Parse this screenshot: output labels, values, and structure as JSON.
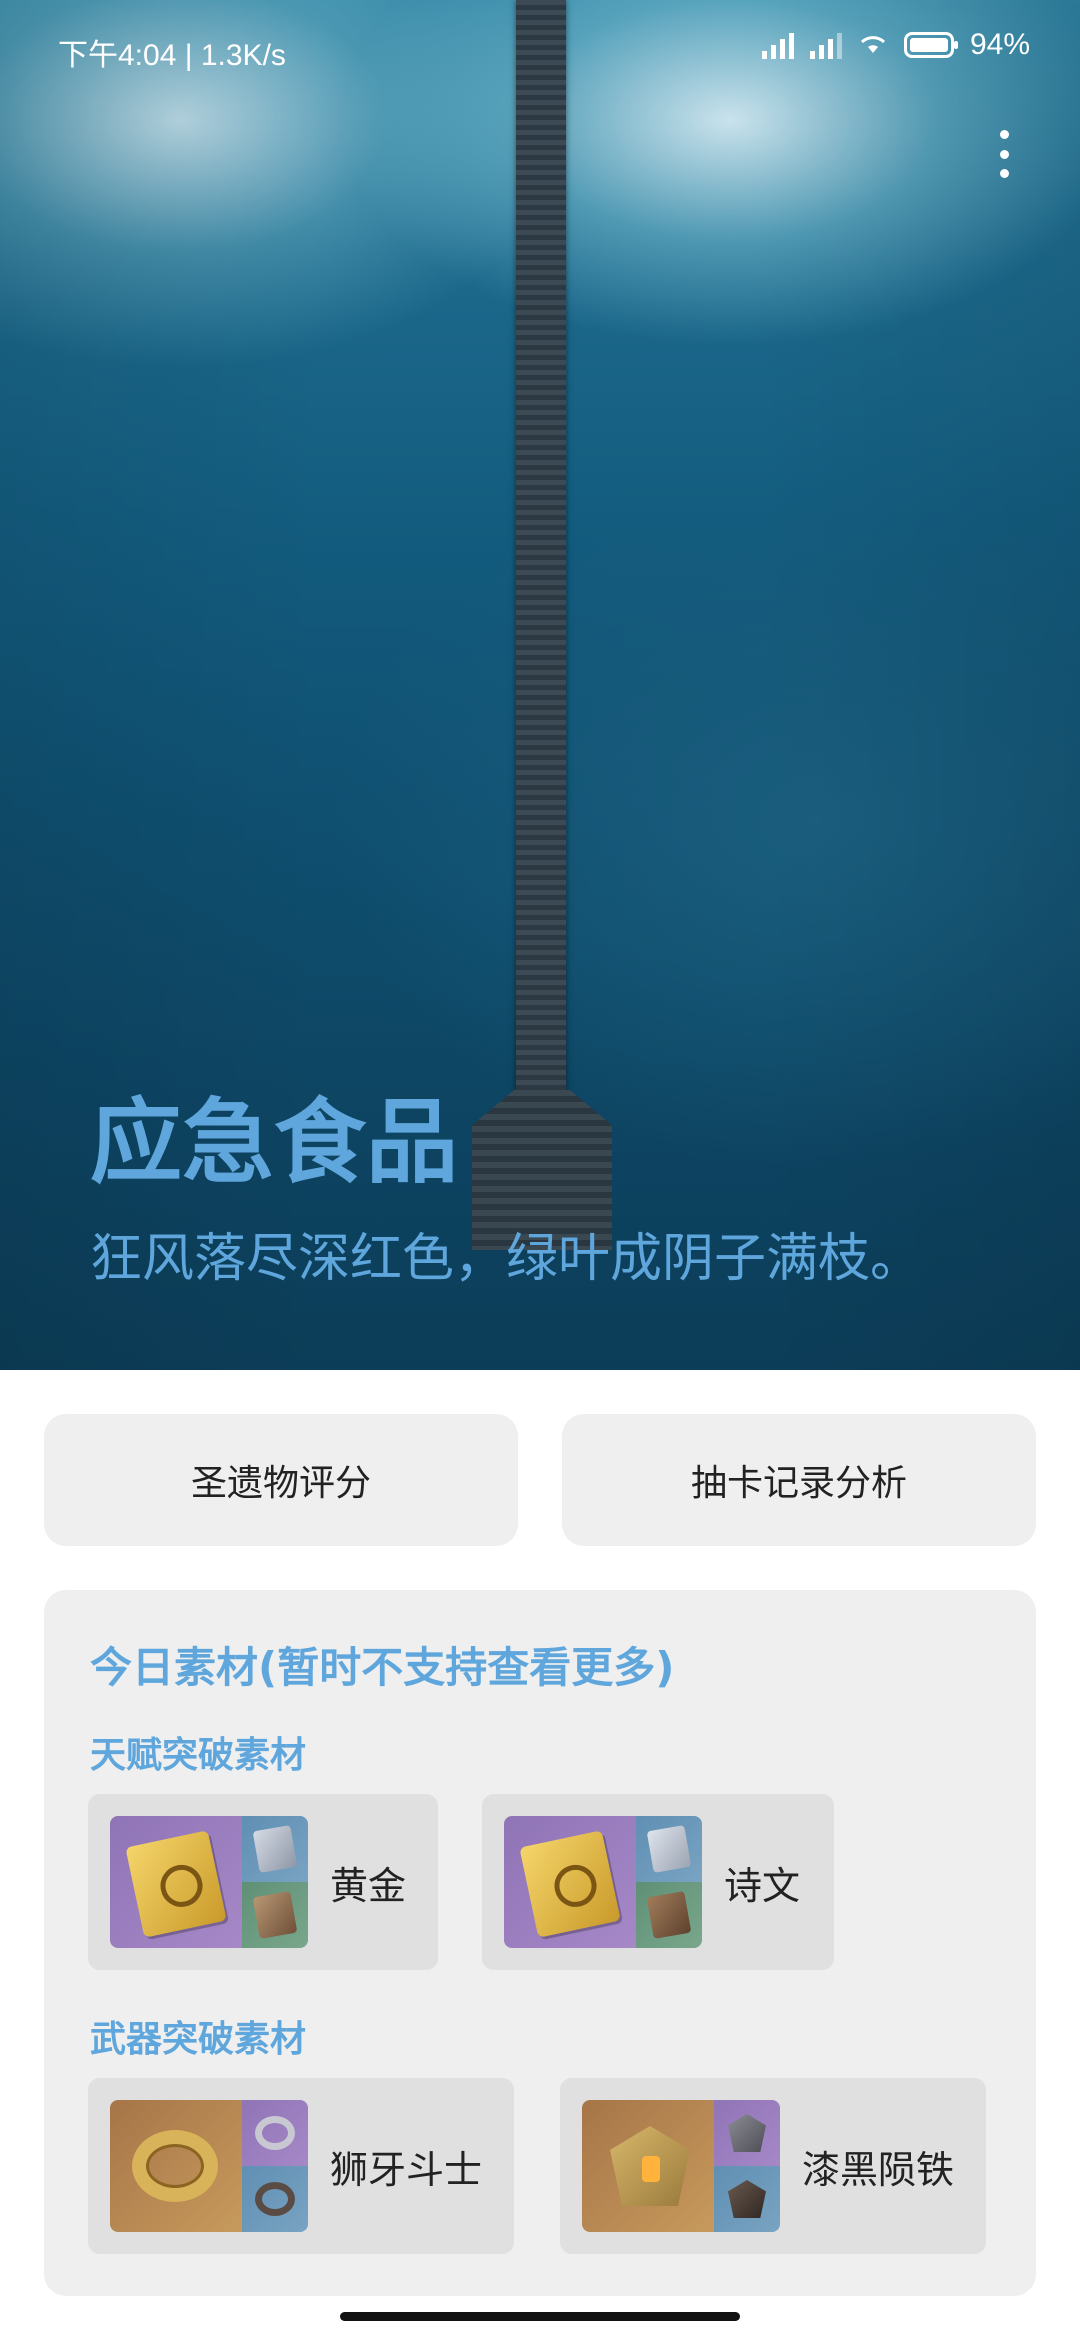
{
  "status_bar": {
    "time_speed": "下午4:04 | 1.3K/s",
    "battery": "94%"
  },
  "hero": {
    "title": "应急食品",
    "subtitle": "狂风落尽深红色，绿叶成阴子满枝。"
  },
  "actions": {
    "artifact_rating": "圣遗物评分",
    "wish_history": "抽卡记录分析"
  },
  "materials": {
    "title": "今日素材(暂时不支持查看更多)",
    "talent": {
      "heading": "天赋突破素材",
      "items": [
        {
          "name": "黄金"
        },
        {
          "name": "诗文"
        }
      ]
    },
    "weapon": {
      "heading": "武器突破素材",
      "items": [
        {
          "name": "狮牙斗士"
        },
        {
          "name": "漆黑陨铁"
        }
      ]
    }
  }
}
